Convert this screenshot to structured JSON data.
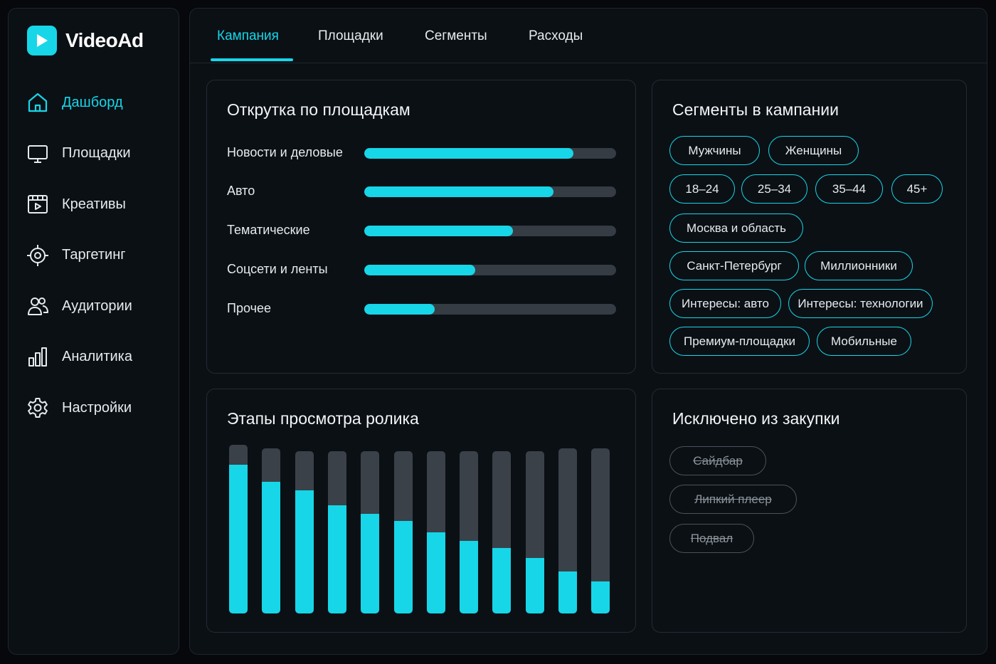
{
  "app": {
    "name": "VideoAd"
  },
  "sidebar": {
    "items": [
      {
        "label": "Дашборд",
        "icon": "home-icon",
        "active": true
      },
      {
        "label": "Площадки",
        "icon": "monitor-icon",
        "active": false
      },
      {
        "label": "Креативы",
        "icon": "video-clip-icon",
        "active": false
      },
      {
        "label": "Таргетинг",
        "icon": "target-icon",
        "active": false
      },
      {
        "label": "Аудитории",
        "icon": "users-icon",
        "active": false
      },
      {
        "label": "Аналитика",
        "icon": "bar-chart-icon",
        "active": false
      },
      {
        "label": "Настройки",
        "icon": "gear-icon",
        "active": false
      }
    ]
  },
  "tabs": [
    {
      "label": "Кампания",
      "active": true
    },
    {
      "label": "Площадки",
      "active": false
    },
    {
      "label": "Сегменты",
      "active": false
    },
    {
      "label": "Расходы",
      "active": false
    }
  ],
  "placements": {
    "title": "Открутка по площадкам",
    "rows": [
      {
        "label": "Новости и деловые",
        "value": 0.83
      },
      {
        "label": "Авто",
        "value": 0.75
      },
      {
        "label": "Тематические",
        "value": 0.59
      },
      {
        "label": "Соцсети и ленты",
        "value": 0.44
      },
      {
        "label": "Прочее",
        "value": 0.28
      }
    ]
  },
  "segments": {
    "title": "Сегменты в кампании",
    "chips": [
      "Мужчины",
      "Женщины",
      "18–24",
      "25–34",
      "35–44",
      "45+",
      "Москва и область",
      "Санкт-Петербург",
      "Миллионники",
      "Интересы: авто",
      "Интересы: технологии",
      "Премиум-площадки",
      "Мобильные"
    ]
  },
  "stages": {
    "title": "Этапы просмотра ролика"
  },
  "chart_data": {
    "type": "bar",
    "categories": [],
    "values": [
      0.88,
      0.78,
      0.73,
      0.64,
      0.59,
      0.55,
      0.48,
      0.43,
      0.39,
      0.33,
      0.25,
      0.19
    ],
    "totals": [
      1.0,
      0.98,
      0.96,
      0.96,
      0.96,
      0.96,
      0.96,
      0.96,
      0.96,
      0.96,
      0.98,
      0.98
    ]
  },
  "excluded": {
    "title": "Исключено из закупки",
    "chips": [
      "Сайдбар",
      "Липкий плеер",
      "Подвал"
    ]
  },
  "colors": {
    "accent": "#17d6e8",
    "track": "#353c44",
    "panel": "#0b1015"
  }
}
